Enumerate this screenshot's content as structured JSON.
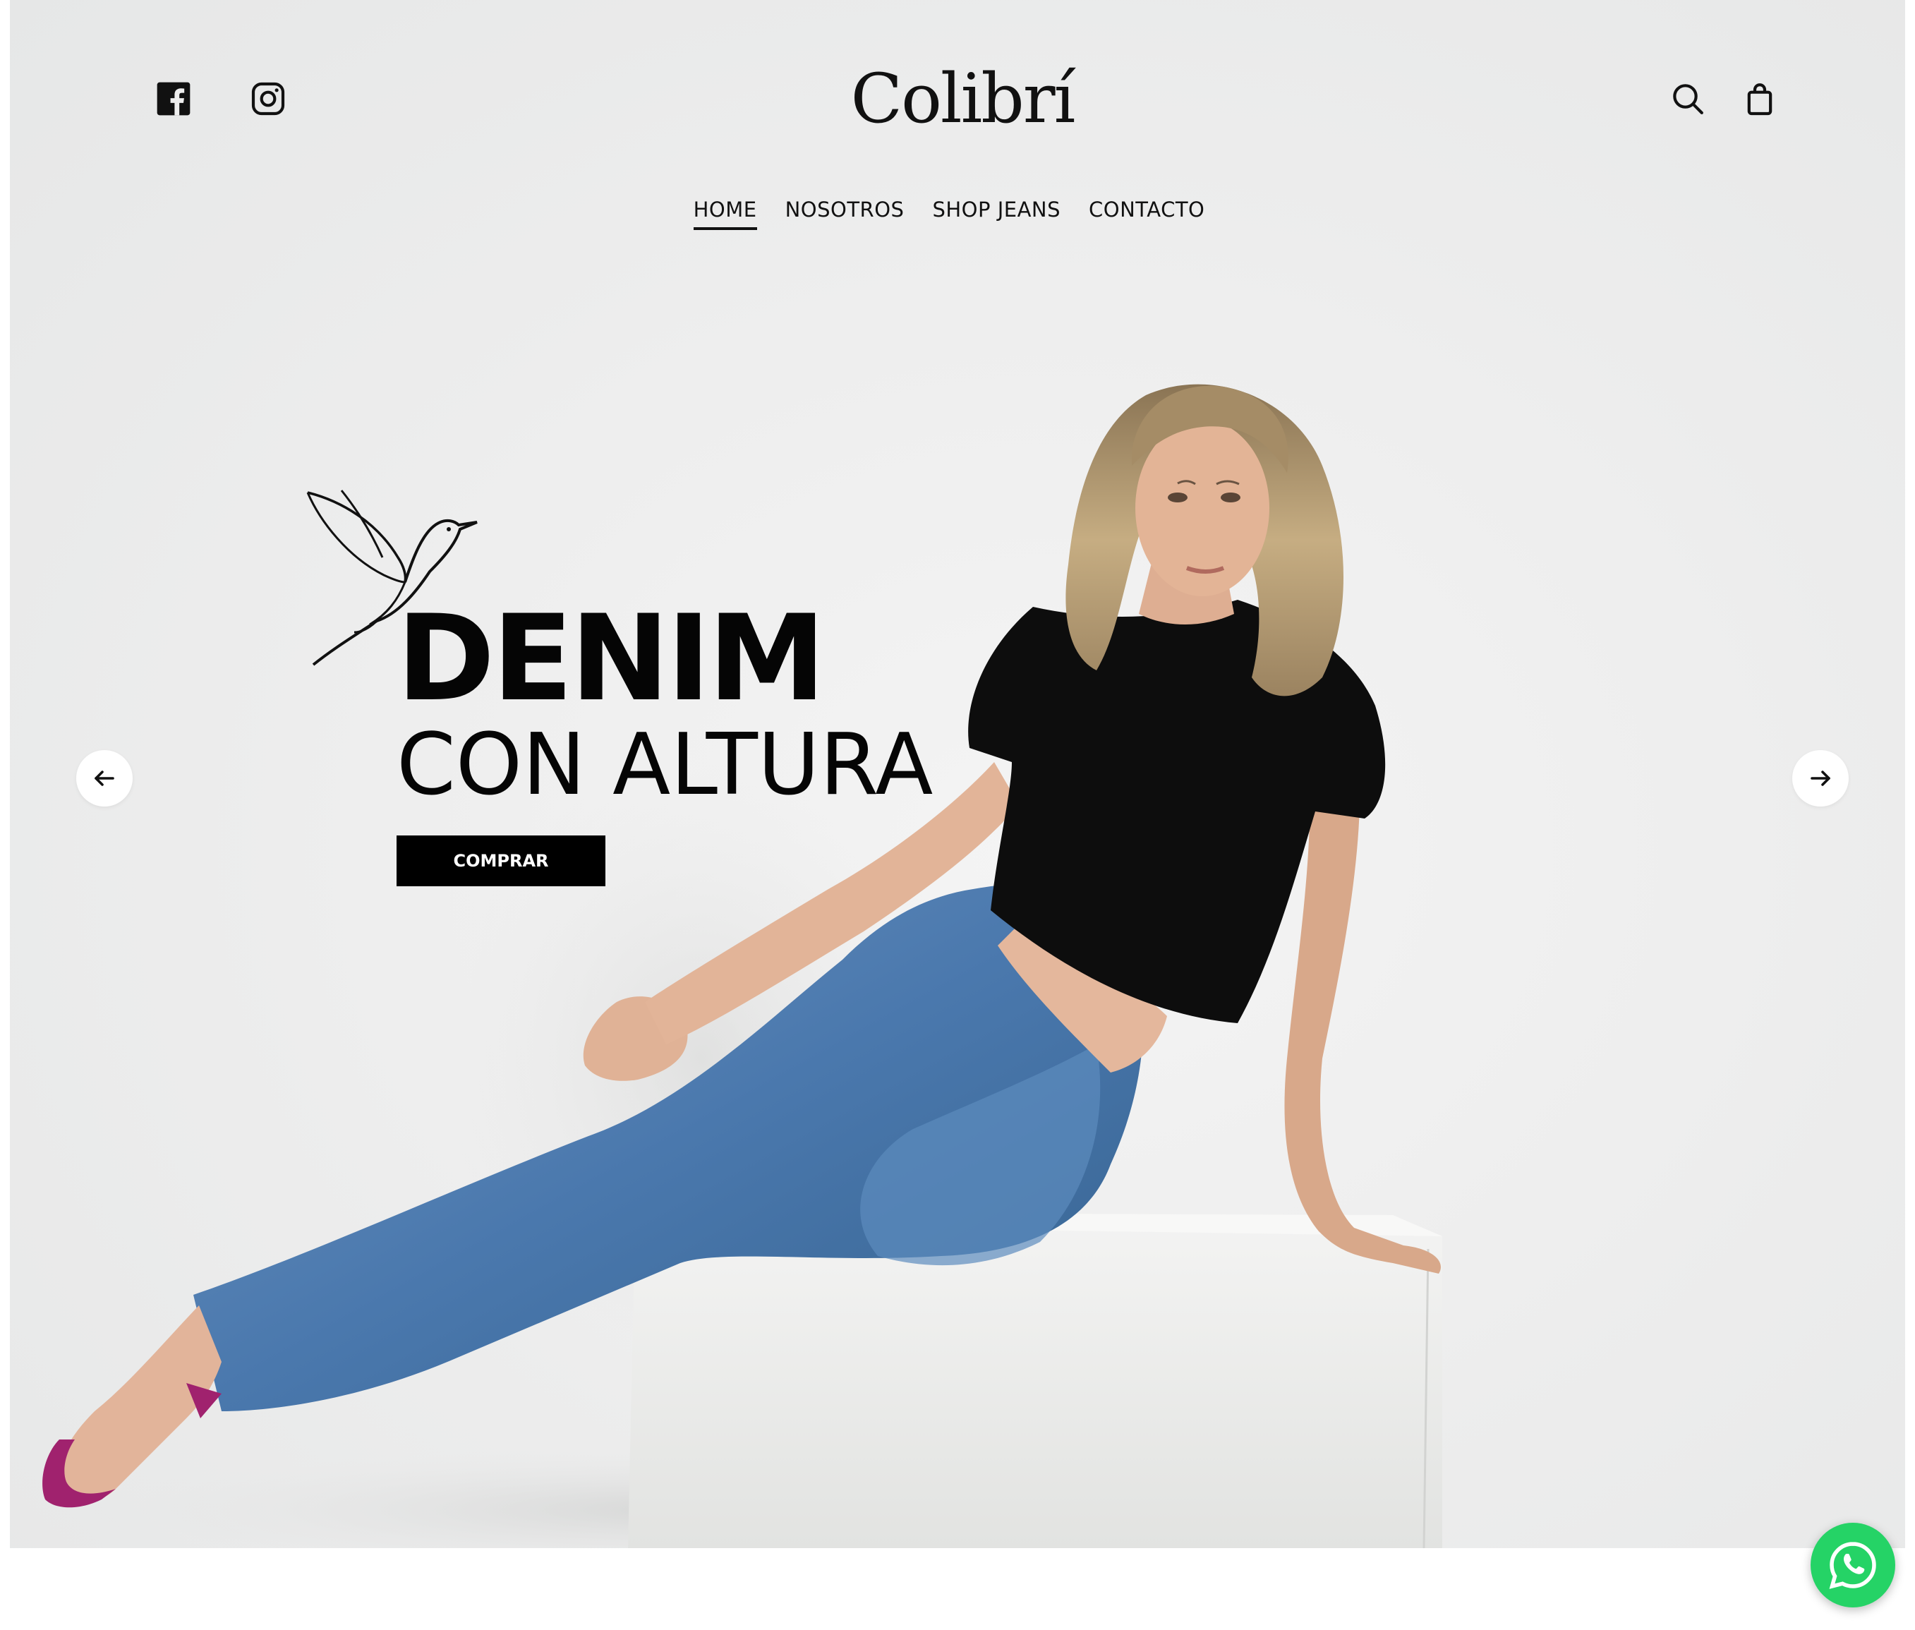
{
  "brand": {
    "logo_text": "Colibrí"
  },
  "header": {
    "social": [
      {
        "icon": "facebook-icon"
      },
      {
        "icon": "instagram-icon"
      }
    ],
    "actions": [
      {
        "icon": "search-icon"
      },
      {
        "icon": "shopping-bag-icon"
      }
    ]
  },
  "nav": {
    "items": [
      {
        "label": "HOME",
        "active": true
      },
      {
        "label": "NOSOTROS",
        "active": false
      },
      {
        "label": "SHOP JEANS",
        "active": false
      },
      {
        "label": "CONTACTO",
        "active": false
      }
    ]
  },
  "hero": {
    "headline_line1": "DENIM",
    "headline_line2": "CON ALTURA",
    "cta_label": "COMPRAR",
    "prev_icon": "arrow-left-icon",
    "next_icon": "arrow-right-icon"
  },
  "floating": {
    "whatsapp_icon": "whatsapp-icon"
  },
  "colors": {
    "text": "#111111",
    "background": "#eeeeee",
    "button": "#000000",
    "whatsapp": "#25d366",
    "denim": "#4a78ad",
    "shoe": "#a0226e"
  }
}
